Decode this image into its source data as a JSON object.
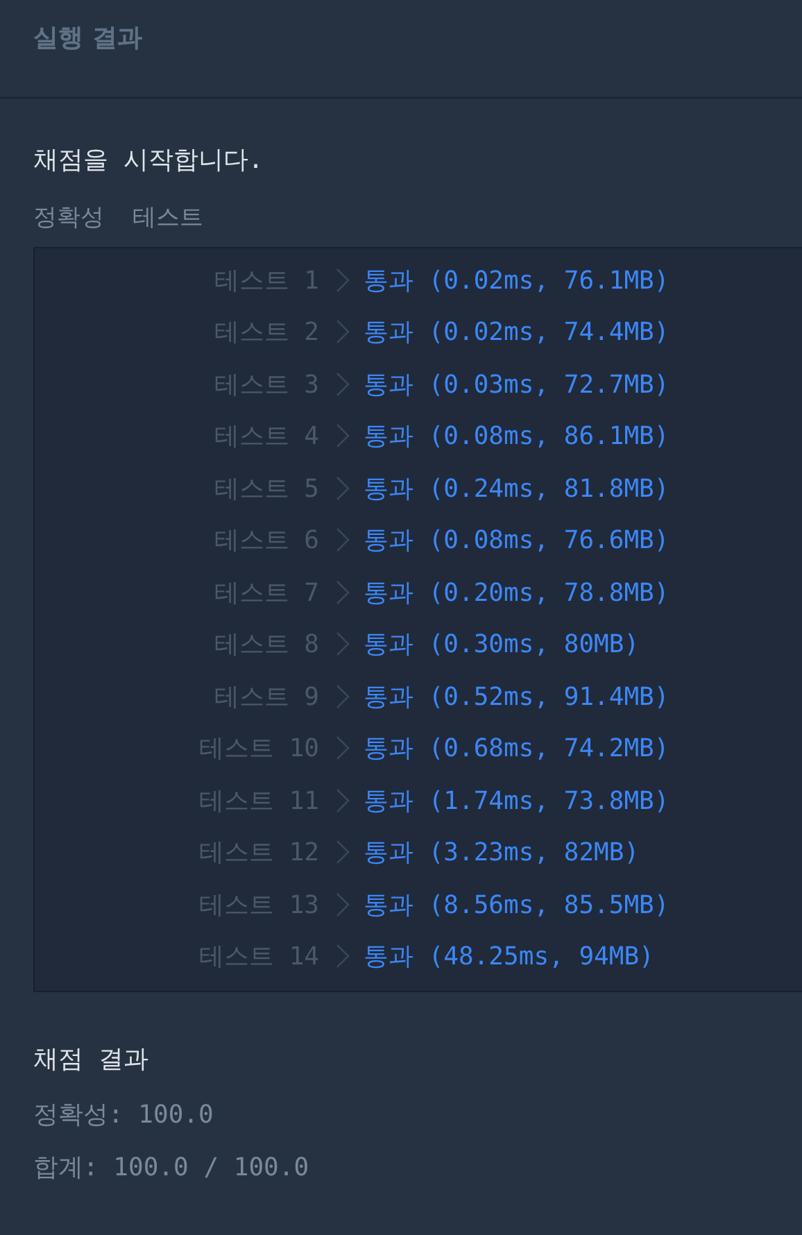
{
  "header": {
    "title": "실행 결과"
  },
  "intro": "채점을 시작합니다.",
  "section_label": "정확성  테스트",
  "tests": [
    {
      "label": "테스트 1",
      "result": "통과 (0.02ms, 76.1MB)"
    },
    {
      "label": "테스트 2",
      "result": "통과 (0.02ms, 74.4MB)"
    },
    {
      "label": "테스트 3",
      "result": "통과 (0.03ms, 72.7MB)"
    },
    {
      "label": "테스트 4",
      "result": "통과 (0.08ms, 86.1MB)"
    },
    {
      "label": "테스트 5",
      "result": "통과 (0.24ms, 81.8MB)"
    },
    {
      "label": "테스트 6",
      "result": "통과 (0.08ms, 76.6MB)"
    },
    {
      "label": "테스트 7",
      "result": "통과 (0.20ms, 78.8MB)"
    },
    {
      "label": "테스트 8",
      "result": "통과 (0.30ms, 80MB)"
    },
    {
      "label": "테스트 9",
      "result": "통과 (0.52ms, 91.4MB)"
    },
    {
      "label": "테스트 10",
      "result": "통과 (0.68ms, 74.2MB)"
    },
    {
      "label": "테스트 11",
      "result": "통과 (1.74ms, 73.8MB)"
    },
    {
      "label": "테스트 12",
      "result": "통과 (3.23ms, 82MB)"
    },
    {
      "label": "테스트 13",
      "result": "통과 (8.56ms, 85.5MB)"
    },
    {
      "label": "테스트 14",
      "result": "통과 (48.25ms, 94MB)"
    }
  ],
  "summary": {
    "title": "채점 결과",
    "lines": [
      "정확성: 100.0",
      "합계: 100.0 / 100.0"
    ]
  }
}
